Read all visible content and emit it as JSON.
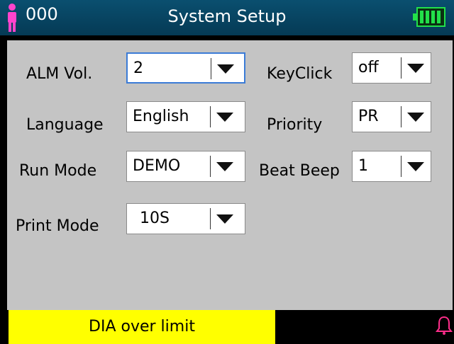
{
  "header": {
    "patient_id": "000",
    "title": "System Setup",
    "patient_icon": "person-icon",
    "battery_icon": "battery-full-icon"
  },
  "settings": {
    "alm_vol": {
      "label": "ALM Vol.",
      "value": "2"
    },
    "keyclick": {
      "label": "KeyClick",
      "value": "off"
    },
    "language": {
      "label": "Language",
      "value": "English"
    },
    "priority": {
      "label": "Priority",
      "value": "PR"
    },
    "run_mode": {
      "label": "Run Mode",
      "value": "DEMO"
    },
    "beat_beep": {
      "label": "Beat Beep",
      "value": "1"
    },
    "print_mode": {
      "label": "Print Mode",
      "value": "10S"
    }
  },
  "status": {
    "alarm_text": "DIA over limit",
    "bell_icon": "alarm-bell-icon"
  },
  "colors": {
    "titlebar": "#0a4f6f",
    "panel": "#c4c4c4",
    "alarm_bg": "#ffff00",
    "battery": "#22e04a",
    "person": "#ff44cc",
    "bell": "#ff2d8a",
    "focus": "#3b7bd6"
  }
}
